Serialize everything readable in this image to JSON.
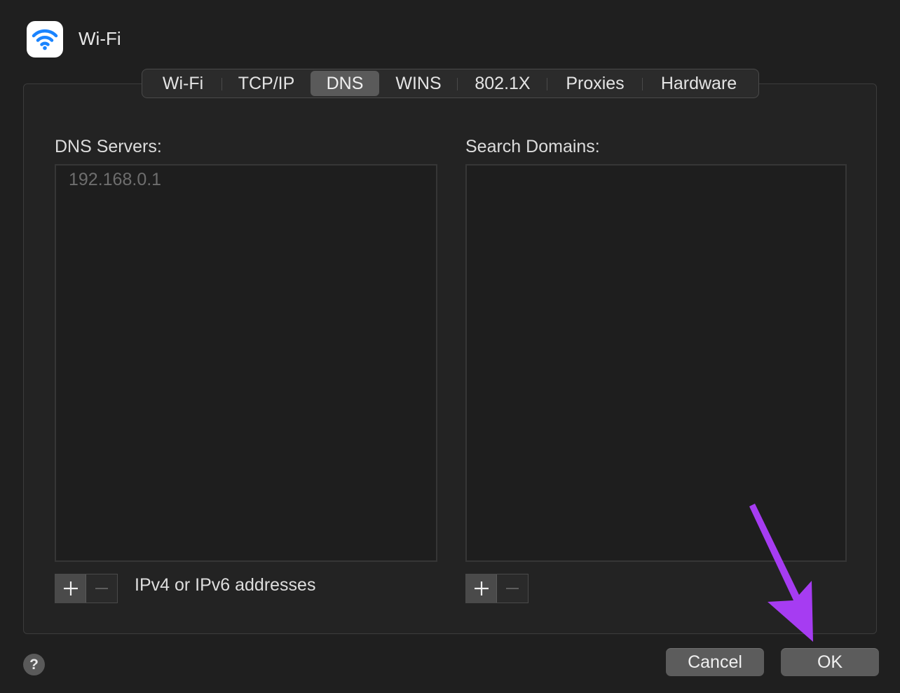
{
  "header": {
    "title": "Wi-Fi",
    "icon": "wifi-icon"
  },
  "tabs": [
    {
      "label": "Wi-Fi",
      "active": false
    },
    {
      "label": "TCP/IP",
      "active": false
    },
    {
      "label": "DNS",
      "active": true
    },
    {
      "label": "WINS",
      "active": false
    },
    {
      "label": "802.1X",
      "active": false
    },
    {
      "label": "Proxies",
      "active": false
    },
    {
      "label": "Hardware",
      "active": false
    }
  ],
  "dns": {
    "label": "DNS Servers:",
    "entries": [
      "192.168.0.1"
    ],
    "hint": "IPv4 or IPv6 addresses"
  },
  "search": {
    "label": "Search Domains:",
    "entries": []
  },
  "buttons": {
    "help": "?",
    "cancel": "Cancel",
    "ok": "OK"
  },
  "colors": {
    "background": "#1f1f1f",
    "wifi_blue": "#1a84ff",
    "annotation_arrow": "#a63cf2"
  }
}
